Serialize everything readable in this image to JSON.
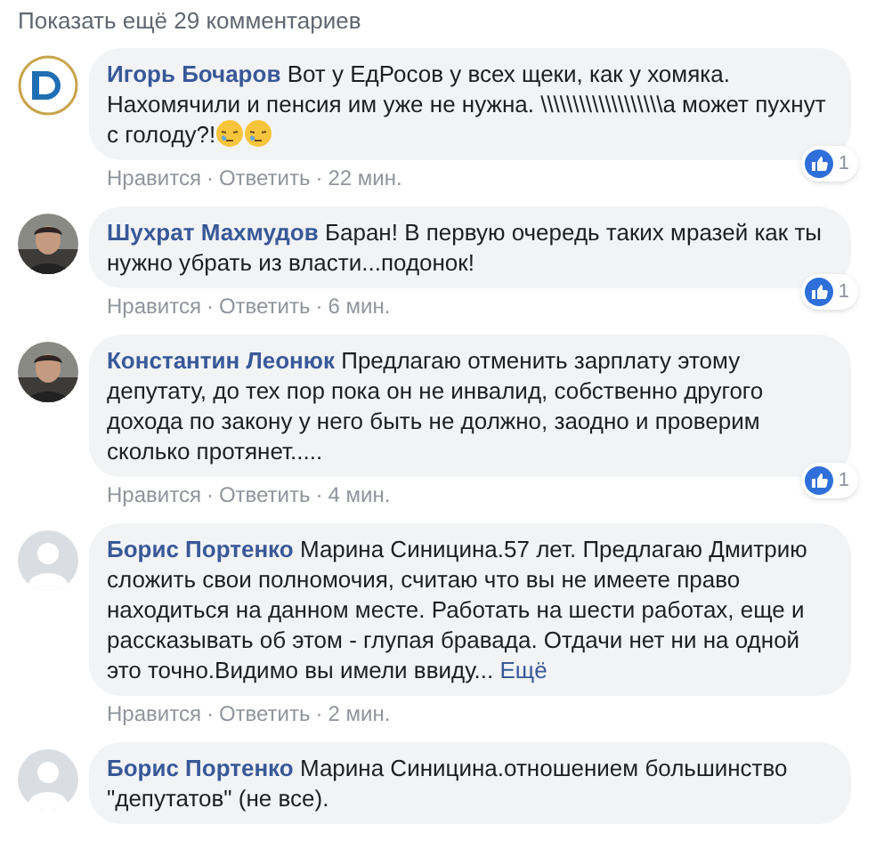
{
  "show_more": "Показать ещё 29 комментариев",
  "comments": [
    {
      "avatar": {
        "kind": "logo"
      },
      "author": "Игорь Бочаров",
      "text": "Вот у ЕдРосов у всех щеки, как у хомяка. Нахомячили и пенсия им уже не нужна. \\\\\\\\\\\\\\\\\\\\\\\\\\\\\\\\\\\\\\а может пухнут с голоду?!",
      "emojis": [
        {
          "kind": "sleepy"
        },
        {
          "kind": "sleepy"
        }
      ],
      "likes": "1",
      "like": "Нравится",
      "separator": "·",
      "reply": "Ответить",
      "separator_2": "·",
      "time": "22 мин."
    },
    {
      "author": "Шухрат Махмудов",
      "text": "Баран! В первую очередь таких мразей как ты нужно убрать из власти...подонок!",
      "likes": "1",
      "like": "Нравится",
      "separator": "·",
      "reply": "Ответить",
      "separator_2": "·",
      "time": "6 мин."
    },
    {
      "author": "Константин Леонюк",
      "text": "Предлагаю отменить зарплату этому депутату, до тех пор пока он не инвалид, собственно другого дохода по закону у него быть не должно, заодно и проверим сколько протянет.....",
      "likes": "1",
      "like": "Нравится",
      "separator": "·",
      "reply": "Ответить",
      "separator_2": "·",
      "time": "4 мин."
    },
    {
      "avatar": {
        "kind": "default"
      },
      "author": "Борис Портенко",
      "text": "Марина Синицина.57 лет. Предлагаю Дмитрию сложить свои полномочия, считаю что вы не имеете право находиться на данном месте. Работать на шести работах, еще и рассказывать об этом - глупая бравада. Отдачи нет ни на одной это точно.Видимо вы имели ввиду...",
      "more": "Ещё",
      "like": "Нравится",
      "separator": "·",
      "reply": "Ответить",
      "separator_2": "·",
      "time": "2 мин."
    },
    {
      "avatar": {
        "kind": "default"
      },
      "author": "Борис Портенко",
      "text": "Марина Синицина.отношением большинство \"депутатов\" (не все)."
    }
  ]
}
